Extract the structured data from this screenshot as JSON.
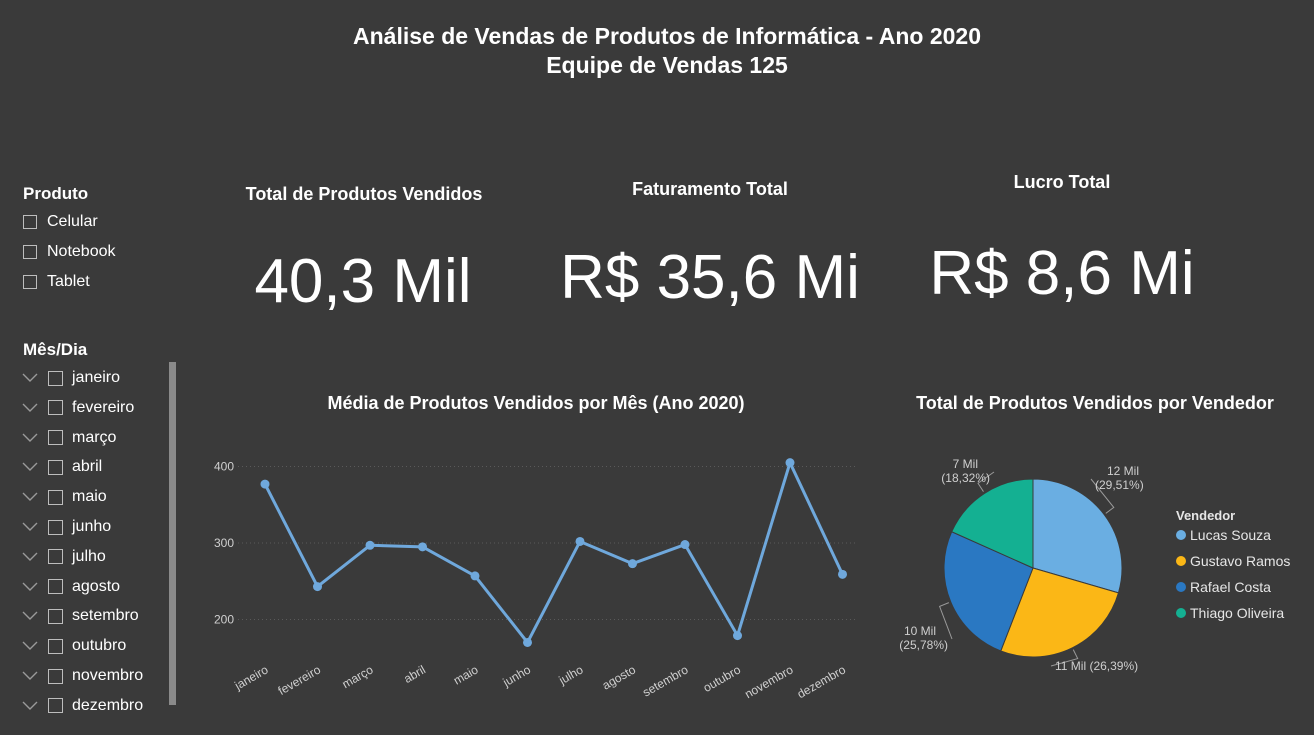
{
  "header": {
    "title_line1": "Análise de Vendas de Produtos de Informática - Ano 2020",
    "title_line2": "Equipe de Vendas 125"
  },
  "slicer_produto": {
    "title": "Produto",
    "items": [
      "Celular",
      "Notebook",
      "Tablet"
    ]
  },
  "slicer_mes": {
    "title": "Mês/Dia",
    "items": [
      "janeiro",
      "fevereiro",
      "março",
      "abril",
      "maio",
      "junho",
      "julho",
      "agosto",
      "setembro",
      "outubro",
      "novembro",
      "dezembro"
    ]
  },
  "cards": {
    "total_produtos": {
      "title": "Total de Produtos Vendidos",
      "value": "40,3 Mil"
    },
    "faturamento": {
      "title": "Faturamento Total",
      "value": "R$ 35,6 Mi"
    },
    "lucro": {
      "title": "Lucro Total",
      "value": "R$ 8,6 Mi"
    }
  },
  "colors": {
    "background": "#3a3a3a",
    "line": "#6fa8dc",
    "lucas": "#6aaee2",
    "gustavo": "#fbb716",
    "rafael": "#2a78c2",
    "thiago": "#14b092"
  },
  "chart_data": [
    {
      "type": "line",
      "title": "Média de Produtos Vendidos por Mês (Ano 2020)",
      "categories": [
        "janeiro",
        "fevereiro",
        "março",
        "abril",
        "maio",
        "junho",
        "julho",
        "agosto",
        "setembro",
        "outubro",
        "novembro",
        "dezembro"
      ],
      "values": [
        377,
        243,
        297,
        295,
        257,
        170,
        302,
        273,
        298,
        179,
        405,
        259
      ],
      "yticks": [
        200,
        300,
        400
      ],
      "ylim": [
        160,
        420
      ],
      "grid": true
    },
    {
      "type": "pie",
      "title": "Total de Produtos Vendidos por Vendedor",
      "legend_title": "Vendedor",
      "legend_position": "right",
      "slices": [
        {
          "name": "Lucas Souza",
          "percent": 29.51,
          "label_value": "12 Mil",
          "label_pct": "(29,51%)",
          "color": "#6aaee2"
        },
        {
          "name": "Gustavo Ramos",
          "percent": 26.39,
          "label_value": "11 Mil",
          "label_pct": "(26,39%)",
          "color": "#fbb716"
        },
        {
          "name": "Rafael Costa",
          "percent": 25.78,
          "label_value": "10 Mil",
          "label_pct": "(25,78%)",
          "color": "#2a78c2"
        },
        {
          "name": "Thiago Oliveira",
          "percent": 18.32,
          "label_value": "7 Mil",
          "label_pct": "(18,32%)",
          "color": "#14b092"
        }
      ]
    }
  ]
}
